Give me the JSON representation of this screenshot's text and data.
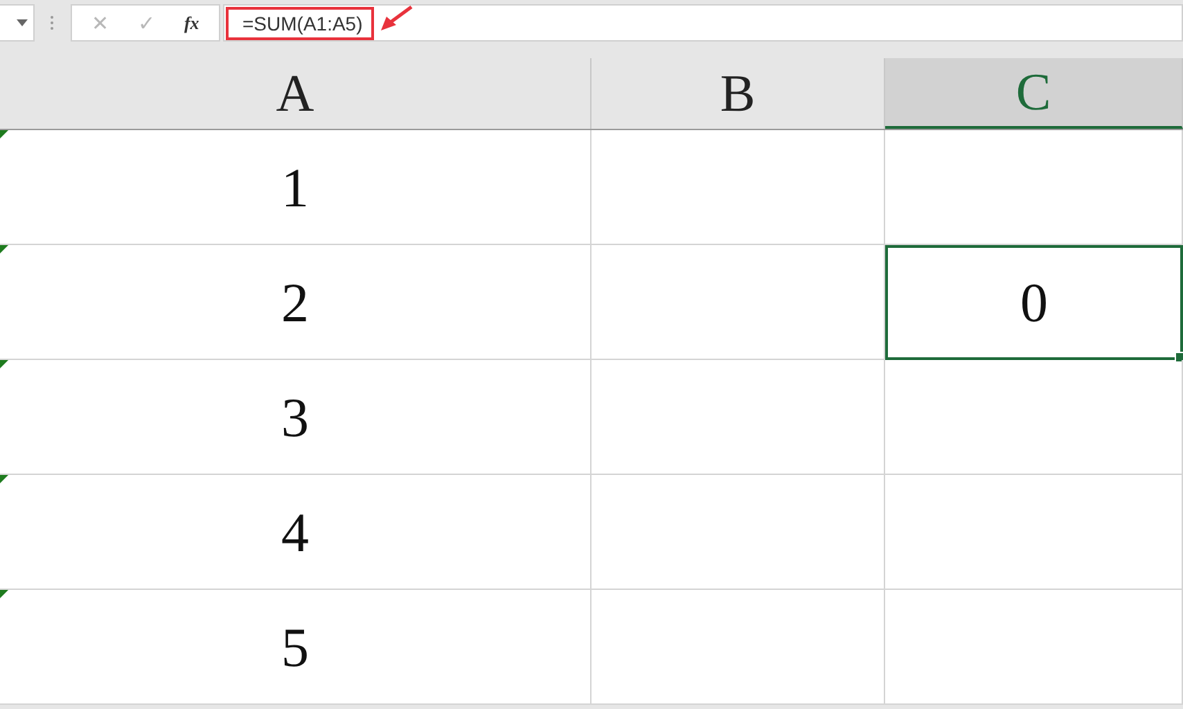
{
  "formula_bar": {
    "cancel": "✕",
    "enter": "✓",
    "function": "fx",
    "formula": "=SUM(A1:A5)",
    "highlighted": true
  },
  "columns": [
    {
      "label": "A",
      "selected": false
    },
    {
      "label": "B",
      "selected": false
    },
    {
      "label": "C",
      "selected": true
    }
  ],
  "rows": [
    {
      "cells": [
        {
          "value": "1",
          "error_flag": true,
          "selected": false
        },
        {
          "error_flag": false,
          "selected": false
        },
        {
          "error_flag": false,
          "selected": false
        }
      ]
    },
    {
      "cells": [
        {
          "value": "2",
          "error_flag": true,
          "selected": false
        },
        {
          "error_flag": false,
          "selected": false
        },
        {
          "value": "0",
          "error_flag": false,
          "selected": true
        }
      ]
    },
    {
      "cells": [
        {
          "value": "3",
          "error_flag": true,
          "selected": false
        },
        {
          "error_flag": false,
          "selected": false
        },
        {
          "error_flag": false,
          "selected": false
        }
      ]
    },
    {
      "cells": [
        {
          "value": "4",
          "error_flag": true,
          "selected": false
        },
        {
          "error_flag": false,
          "selected": false
        },
        {
          "error_flag": false,
          "selected": false
        }
      ]
    },
    {
      "cells": [
        {
          "value": "5",
          "error_flag": true,
          "selected": false
        },
        {
          "error_flag": false,
          "selected": false
        },
        {
          "error_flag": false,
          "selected": false
        }
      ]
    }
  ]
}
